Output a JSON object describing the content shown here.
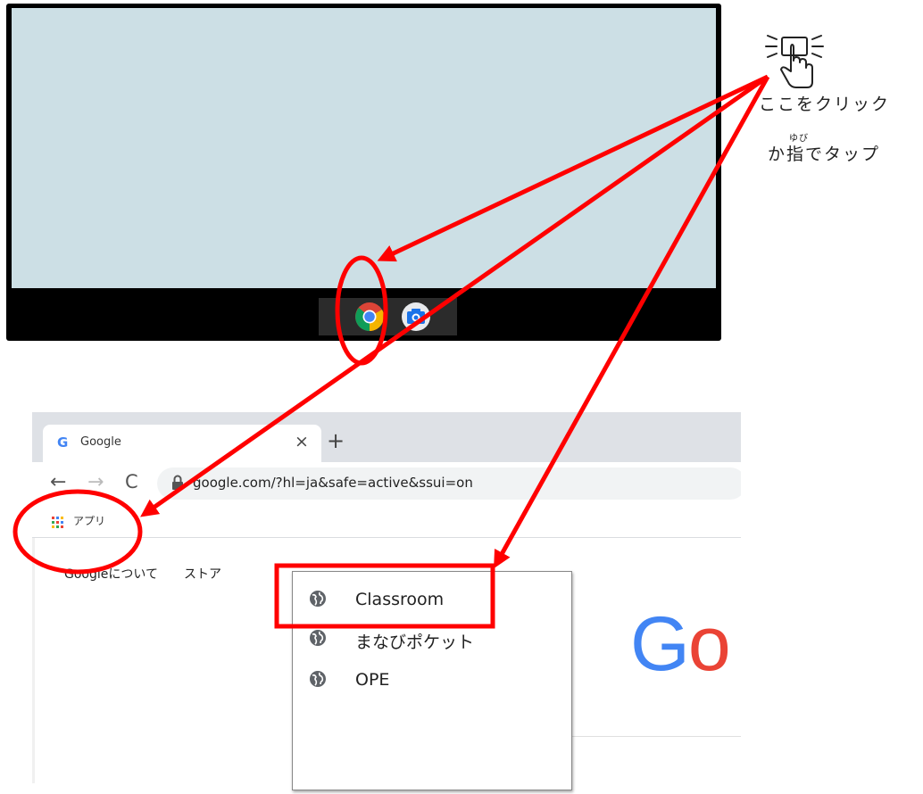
{
  "hint": {
    "line1": "ここをクリック",
    "line2": "か指でタップ",
    "ruby": "ゆび"
  },
  "desktop": {
    "shelf_apps": [
      "chrome-app",
      "camera-app"
    ]
  },
  "browser": {
    "tab": {
      "favicon": "G",
      "title": "Google",
      "close": "×"
    },
    "new_tab": "+",
    "nav": {
      "back": "←",
      "forward": "→",
      "reload": "C"
    },
    "url": "google.com/?hl=ja&safe=active&ssui=on",
    "bookmarks": {
      "apps_label": "アプリ"
    },
    "page": {
      "about": "Googleについて",
      "store": "ストア",
      "logo_letters": [
        "G",
        "o"
      ]
    },
    "apps_menu": {
      "items": [
        "Classroom",
        "まなびポケット",
        "OPE"
      ]
    }
  },
  "colors": {
    "annotation": "#ff0000",
    "google_blue": "#4285f4",
    "google_red": "#ea4335",
    "screen_bg": "#ccdfe5"
  }
}
